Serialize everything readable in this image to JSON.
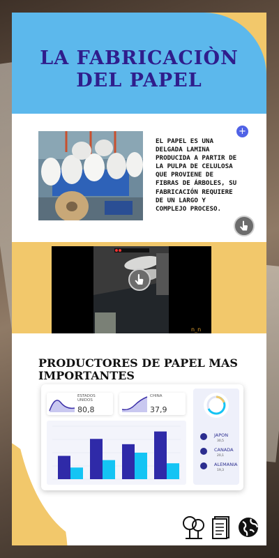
{
  "header": {
    "title_line1": "LA FABRICACIÒN",
    "title_line2": "DEL PAPEL"
  },
  "intro": {
    "lines": [
      "EL PAPEL ES UNA",
      "DELGADA LAMINA",
      "PRODUCIDA A PARTIR DE",
      "LA PULPA DE CELULOSA",
      "QUE PROVIENE DE",
      "FIBRAS DE ÁRBOLES, SU",
      "FABRICACIÓN REQUIERE",
      "DE UN LARGO Y",
      "COMPLEJO PROCESO."
    ],
    "plus_label": "+"
  },
  "producers": {
    "title_line1": "PRODUCTORES DE PAPEL MAS",
    "title_line2": "IMPORTANTES",
    "stats": [
      {
        "label_line1": "ESTADOS",
        "label_line2": "UNIDOS",
        "value": "80,8"
      },
      {
        "label_line1": "CHINA",
        "label_line2": "",
        "value": "37,9"
      }
    ],
    "legend": [
      {
        "name": "JAPON",
        "value": "30,5"
      },
      {
        "name": "CANADA",
        "value": "20,1"
      },
      {
        "name": "ALEMANIA",
        "value": "19,3"
      }
    ]
  },
  "chart_data": {
    "type": "bar",
    "title": "",
    "categories": [
      "",
      "",
      "",
      ""
    ],
    "series": [
      {
        "values": [
          0.44,
          0.76,
          0.66,
          0.9
        ]
      },
      {
        "values": [
          0.22,
          0.36,
          0.5,
          0.3
        ]
      }
    ],
    "ylim": [
      0,
      1
    ],
    "grid": true,
    "legend": "none"
  },
  "colors": {
    "title": "#2f1d8c",
    "header_blue": "#5cb8ec",
    "accent_yellow": "#f2c86b",
    "bar_dark": "#2f2aa8",
    "bar_light": "#14c4f4",
    "button_blue": "#5062e6"
  },
  "icons": [
    "plus-icon",
    "touch-icon",
    "trees-icon",
    "document-icon",
    "globe-icon"
  ]
}
